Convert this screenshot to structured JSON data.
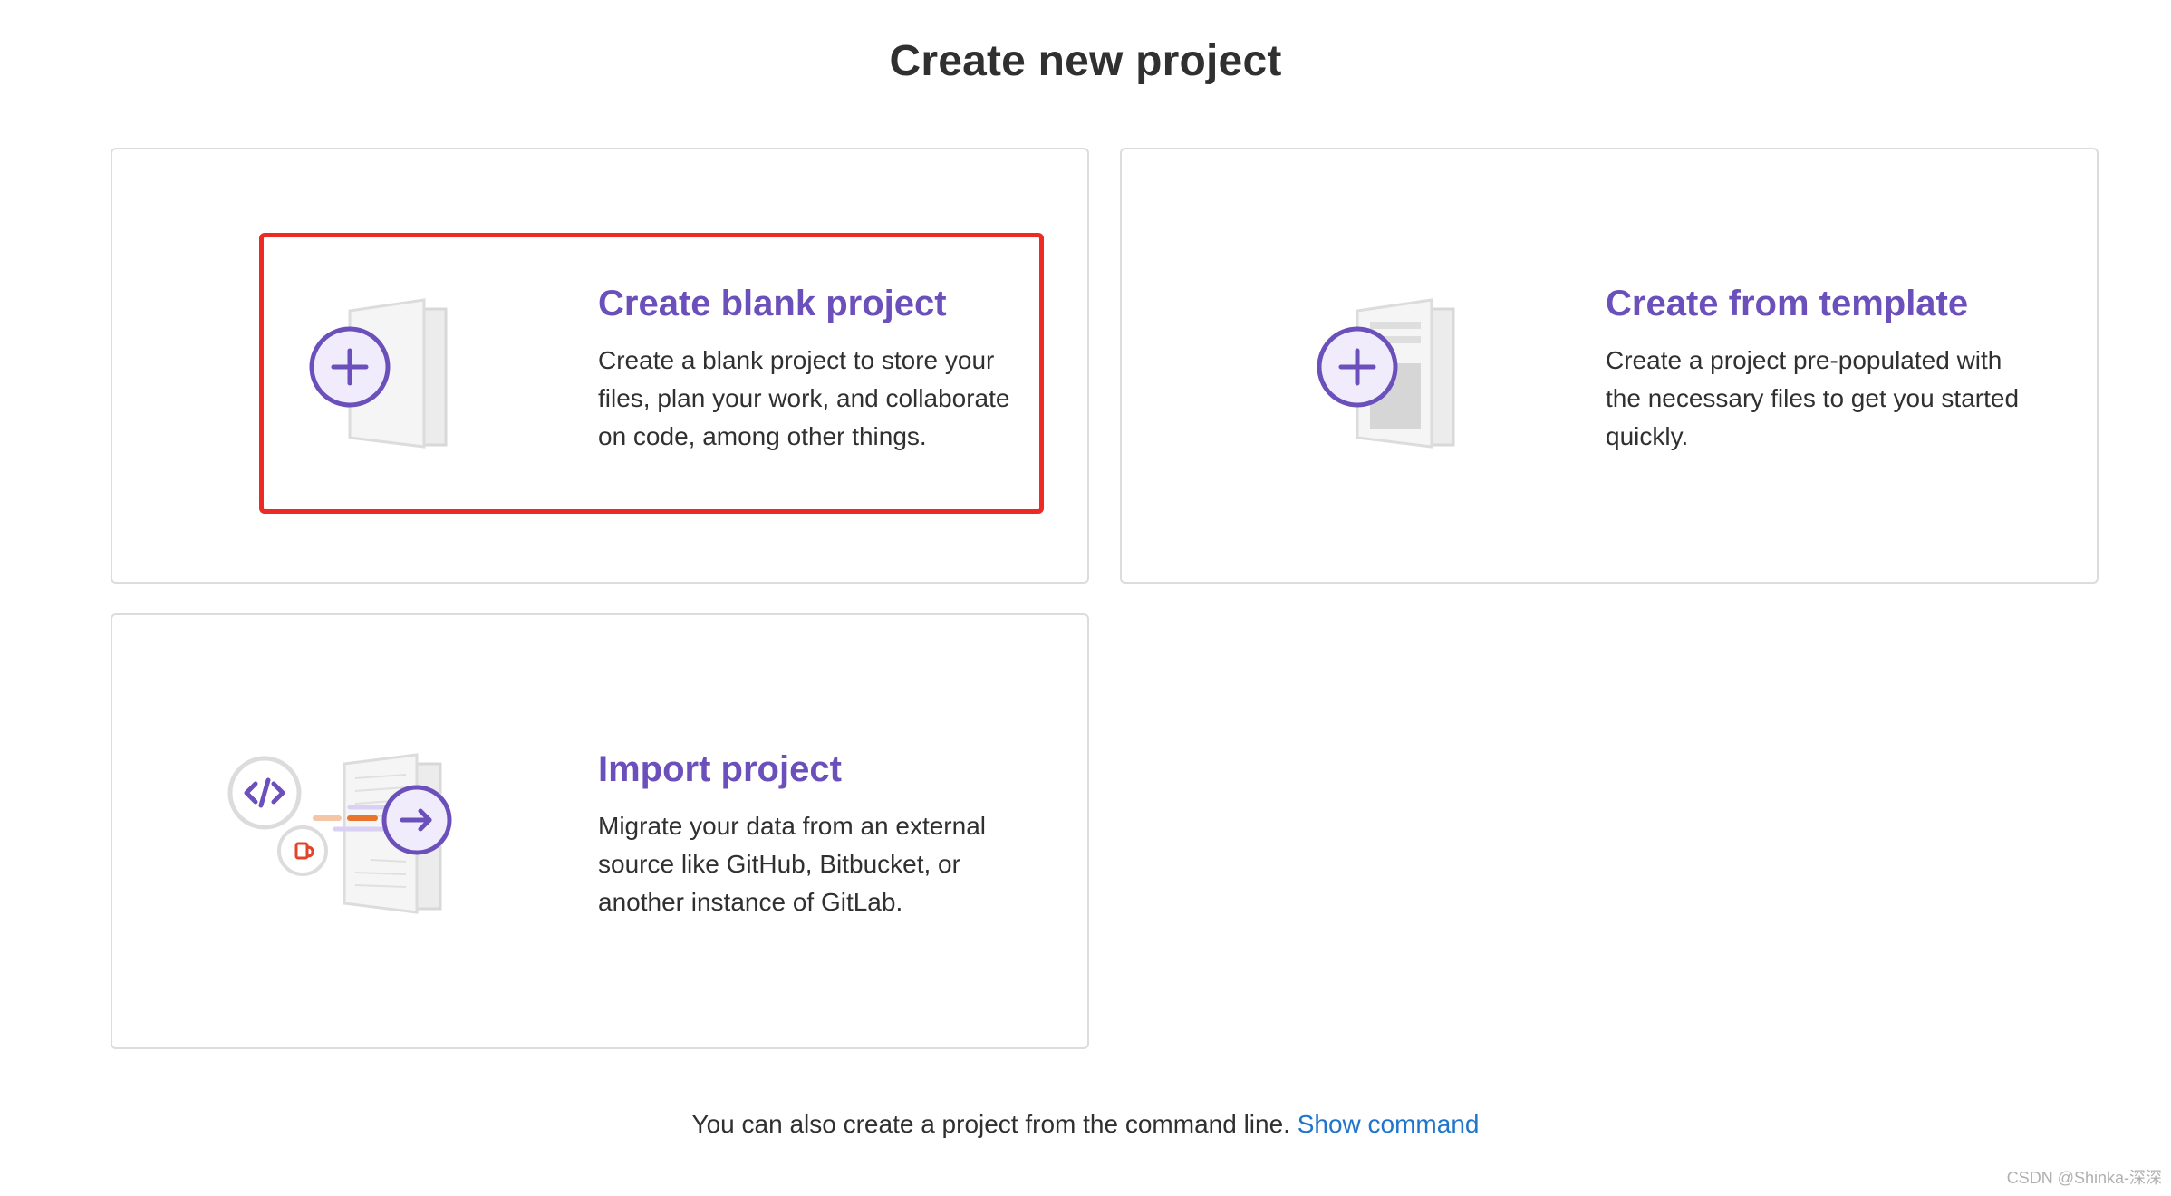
{
  "page": {
    "title": "Create new project"
  },
  "cards": {
    "blank": {
      "title": "Create blank project",
      "description": "Create a blank project to store your files, plan your work, and collaborate on code, among other things."
    },
    "template": {
      "title": "Create from template",
      "description": "Create a project pre-populated with the necessary files to get you started quickly."
    },
    "import": {
      "title": "Import project",
      "description": "Migrate your data from an external source like GitHub, Bitbucket, or another instance of GitLab."
    }
  },
  "footer": {
    "text": "You can also create a project from the command line.",
    "link_label": "Show command"
  },
  "watermark": "CSDN @Shinka-深深",
  "icons": {
    "blank": "blank-project-icon",
    "template": "template-project-icon",
    "import": "import-project-icon"
  },
  "colors": {
    "accent_purple": "#6b4fbb",
    "link_blue": "#1f75cb",
    "highlight_red": "#ee2a24",
    "border_gray": "#dcdcde"
  }
}
